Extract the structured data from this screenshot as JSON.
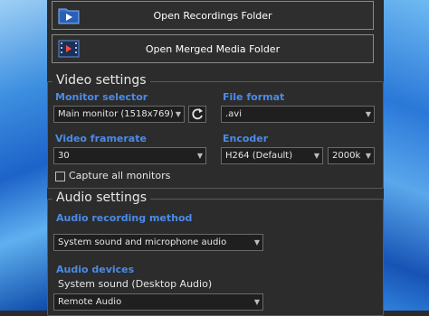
{
  "buttons": {
    "open_recordings": "Open Recordings Folder",
    "open_merged": "Open Merged Media Folder"
  },
  "video": {
    "title": "Video settings",
    "monitor_label": "Monitor selector",
    "monitor_value": "Main monitor (1518x769)",
    "format_label": "File format",
    "format_value": ".avi",
    "framerate_label": "Video framerate",
    "framerate_value": "30",
    "encoder_label": "Encoder",
    "encoder_value": "H264 (Default)",
    "bitrate_value": "2000k",
    "capture_all_label": "Capture all monitors"
  },
  "audio": {
    "title": "Audio settings",
    "method_label": "Audio recording method",
    "method_value": "System sound and microphone audio",
    "devices_label": "Audio devices",
    "system_sound_label": "System sound (Desktop Audio)",
    "system_sound_value": "Remote Audio"
  },
  "colors": {
    "accent_label": "#4a8be8",
    "panel_bg": "#2c2c2c"
  },
  "icons": {
    "recordings": "video-folder-icon",
    "merged": "film-strip-icon",
    "refresh": "refresh-icon",
    "dropdown": "chevron-down-icon"
  }
}
